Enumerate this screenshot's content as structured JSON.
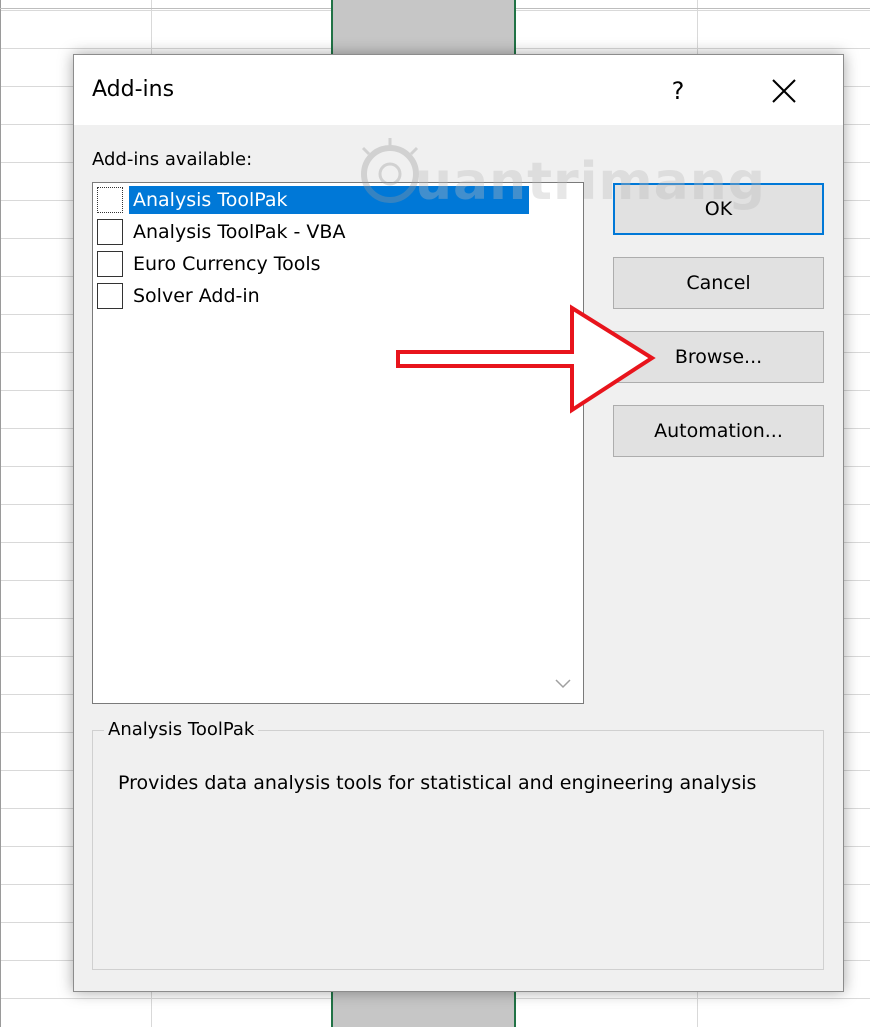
{
  "dialog": {
    "title": "Add-ins",
    "help_label": "?",
    "list_label": "Add-ins available:",
    "items": [
      {
        "label": "Analysis ToolPak",
        "checked": false,
        "selected": true
      },
      {
        "label": "Analysis ToolPak - VBA",
        "checked": false,
        "selected": false
      },
      {
        "label": "Euro Currency Tools",
        "checked": false,
        "selected": false
      },
      {
        "label": "Solver Add-in",
        "checked": false,
        "selected": false
      }
    ],
    "buttons": {
      "ok": "OK",
      "cancel": "Cancel",
      "browse": "Browse...",
      "automation": "Automation..."
    },
    "description": {
      "title": "Analysis ToolPak",
      "text": "Provides data analysis tools for statistical and engineering analysis"
    }
  },
  "watermark": {
    "text": "uantrimang"
  },
  "colors": {
    "selection": "#0078d7",
    "annotation_arrow": "#e8141c",
    "column_select_border": "#217346"
  }
}
